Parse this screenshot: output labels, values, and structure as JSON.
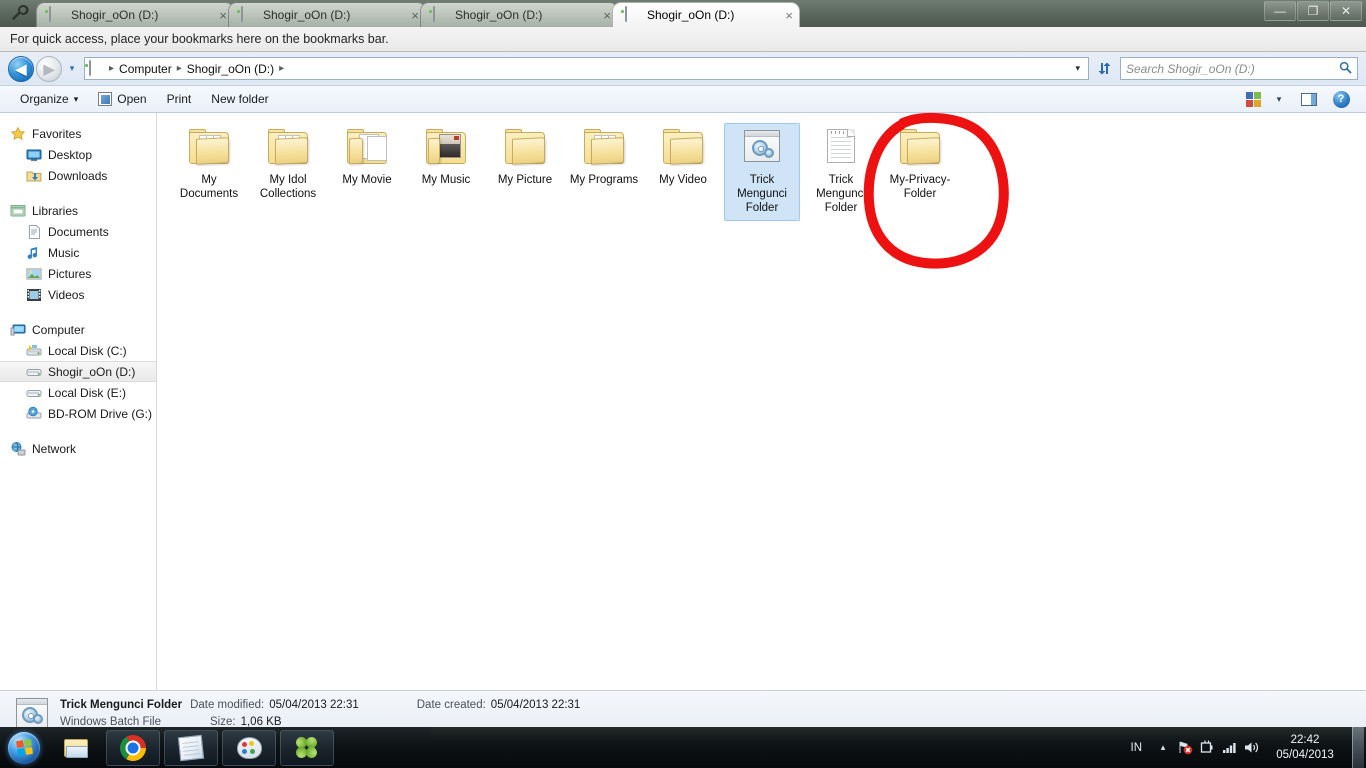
{
  "browser": {
    "menu_icon": "wrench-icon",
    "tabs": [
      {
        "label": "Shogir_oOn (D:)",
        "active": false
      },
      {
        "label": "Shogir_oOn (D:)",
        "active": false
      },
      {
        "label": "Shogir_oOn (D:)",
        "active": false
      },
      {
        "label": "Shogir_oOn (D:)",
        "active": true
      }
    ],
    "close_glyph": "×",
    "window_controls": {
      "minimize": "—",
      "maximize": "❐",
      "close": "✕"
    },
    "bookmarks_bar_text": "For quick access, place your bookmarks here on the bookmarks bar."
  },
  "navbar": {
    "back_glyph": "◀",
    "forward_glyph": "▶",
    "history_glyph": "▾",
    "breadcrumbs": [
      "Computer",
      "Shogir_oOn (D:)"
    ],
    "breadcrumb_sep": "▸",
    "address_dropdown_glyph": "▾",
    "refresh_glyph": "↻",
    "search_placeholder": "Search Shogir_oOn (D:)",
    "search_value": "",
    "search_icon_glyph": "⚲"
  },
  "commandbar": {
    "organize": "Organize",
    "organize_caret": "▾",
    "open": "Open",
    "print": "Print",
    "new_folder": "New folder",
    "view_caret": "▾",
    "help_glyph": "?"
  },
  "sidebar": {
    "groups": [
      {
        "header": {
          "label": "Favorites",
          "icon": "star-icon"
        },
        "items": [
          {
            "label": "Desktop",
            "icon": "desktop-icon"
          },
          {
            "label": "Downloads",
            "icon": "downloads-icon"
          }
        ]
      },
      {
        "header": {
          "label": "Libraries",
          "icon": "libraries-icon"
        },
        "items": [
          {
            "label": "Documents",
            "icon": "document-icon"
          },
          {
            "label": "Music",
            "icon": "music-note-icon"
          },
          {
            "label": "Pictures",
            "icon": "picture-icon"
          },
          {
            "label": "Videos",
            "icon": "film-icon"
          }
        ]
      },
      {
        "header": {
          "label": "Computer",
          "icon": "computer-icon"
        },
        "items": [
          {
            "label": "Local Disk (C:)",
            "icon": "system-drive-icon",
            "selected": false
          },
          {
            "label": "Shogir_oOn (D:)",
            "icon": "drive-icon",
            "selected": true
          },
          {
            "label": "Local Disk (E:)",
            "icon": "drive-icon",
            "selected": false
          },
          {
            "label": "BD-ROM Drive (G:) (",
            "icon": "optical-drive-icon",
            "selected": false
          }
        ]
      },
      {
        "header": {
          "label": "Network",
          "icon": "network-icon"
        },
        "items": []
      }
    ]
  },
  "content": {
    "items": [
      {
        "name": "My Documents",
        "icon": "folder-documents-icon",
        "selected": false
      },
      {
        "name": "My Idol Collections",
        "icon": "folder-documents-icon",
        "selected": false
      },
      {
        "name": "My Movie",
        "icon": "folder-sheets-icon",
        "selected": false
      },
      {
        "name": "My Music",
        "icon": "folder-album-icon",
        "selected": false
      },
      {
        "name": "My Picture",
        "icon": "folder-icon",
        "selected": false
      },
      {
        "name": "My Programs",
        "icon": "folder-documents-icon",
        "selected": false
      },
      {
        "name": "My Video",
        "icon": "folder-icon",
        "selected": false
      },
      {
        "name": "Trick Mengunci Folder",
        "icon": "batch-file-gear-icon",
        "selected": true
      },
      {
        "name": "Trick Mengunci Folder",
        "icon": "text-file-icon",
        "selected": false
      },
      {
        "name": "My-Privacy-Folder",
        "icon": "folder-icon",
        "selected": false
      }
    ],
    "annotation": {
      "shape": "hand-drawn-circle",
      "color": "#ee1111",
      "targets": "My-Privacy-Folder"
    }
  },
  "details_pane": {
    "file_name": "Trick Mengunci Folder",
    "file_type": "Windows Batch File",
    "date_modified_label": "Date modified:",
    "date_modified": "05/04/2013 22:31",
    "date_created_label": "Date created:",
    "date_created": "05/04/2013 22:31",
    "size_label": "Size:",
    "size": "1,06 KB",
    "icon": "batch-file-gear-icon"
  },
  "taskbar": {
    "start_label": "Start",
    "buttons": [
      {
        "name": "windows-explorer",
        "icon": "folder-explorer-icon"
      },
      {
        "name": "google-chrome",
        "icon": "chrome-icon"
      },
      {
        "name": "notepad",
        "icon": "notepad-icon"
      },
      {
        "name": "paint",
        "icon": "paint-palette-icon"
      },
      {
        "name": "clover",
        "icon": "four-leaf-clover-icon"
      }
    ],
    "tray": {
      "language": "IN",
      "show_hidden_glyph": "▴",
      "icons": [
        "network-error-icon",
        "battery-icon",
        "signal-bars-icon",
        "volume-icon"
      ],
      "time": "22:42",
      "date": "05/04/2013"
    }
  },
  "colors": {
    "selection_fill": "#cfe4f7",
    "selection_border": "#a3c8e8",
    "annotation_red": "#ee1111",
    "folder_yellow": "#f6e09a",
    "accent_blue": "#2a6ca8"
  }
}
